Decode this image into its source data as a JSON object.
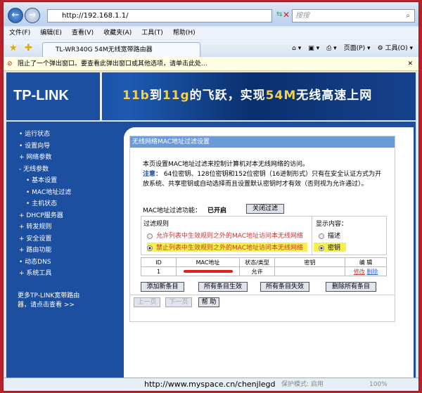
{
  "browser": {
    "url": "http://192.168.1.1/",
    "search_placeholder": "搜搜",
    "menu": [
      "文件(F)",
      "编辑(E)",
      "查看(V)",
      "收藏夹(A)",
      "工具(T)",
      "帮助(H)"
    ],
    "tab_title": "TL-WR340G 54M无线宽带路由器",
    "page_label": "页面(P)",
    "tools_label": "工具(O)",
    "popup_info": "阻止了一个弹出窗口。要查看此弹出窗口或其他选项，请单击此处...",
    "status_url": "http://www.myspace.cn/chenjlegd",
    "protected_mode": "保护模式: 启用",
    "zoom": "100%"
  },
  "banner": {
    "logo": "TP-LINK",
    "slogan_parts": [
      "11b",
      "到",
      "11g",
      "的飞跃，实现",
      "54M",
      "无线高速上网"
    ]
  },
  "sidebar": {
    "items": [
      "• 运行状态",
      "• 设置向导",
      "+ 网络参数",
      "- 无线参数",
      "• 基本设置",
      "• MAC地址过滤",
      "• 主机状态",
      "+ DHCP服务器",
      "+ 转发规则",
      "+ 安全设置",
      "+ 路由功能",
      "• 动态DNS",
      "+ 系统工具"
    ],
    "more": "更多TP-LINK宽带路由器，请点击查看 >>"
  },
  "panel": {
    "title": "无线网络MAC地址过滤设置",
    "intro": "本页设置MAC地址过滤来控制计算机对本无线网络的访问。",
    "note_label": "注意：",
    "note": "64位密钥、128位密钥和152位密钥（16进制形式）只有在安全认证方式为开放系统、共享密钥或自动选择而且设置默认密钥时才有效（否则视为允许通过）。",
    "filter_label": "MAC地址过滤功能：",
    "filter_status": "已开启",
    "close_filter": "关闭过滤",
    "rules_label": "过滤规则",
    "rule_allow": "允许列表中生效规则之外的MAC地址访问本无线网络",
    "rule_deny": "禁止列表中生效规则之外的MAC地址访问本无线网络",
    "display_label": "显示内容：",
    "display_desc": "描述",
    "display_key": "密钥",
    "table": {
      "headers": [
        "ID",
        "MAC地址",
        "状态/类型",
        "密钥",
        "编 辑"
      ],
      "rows": [
        {
          "id": "1",
          "mac": "",
          "status": "允许",
          "key": "",
          "edit": "修改",
          "delete": "删除"
        }
      ]
    },
    "buttons": [
      "添加新条目",
      "所有条目生效",
      "所有条目失效",
      "删除所有条目"
    ],
    "prev": "上一页",
    "next": "下一页",
    "help": "帮 助"
  }
}
